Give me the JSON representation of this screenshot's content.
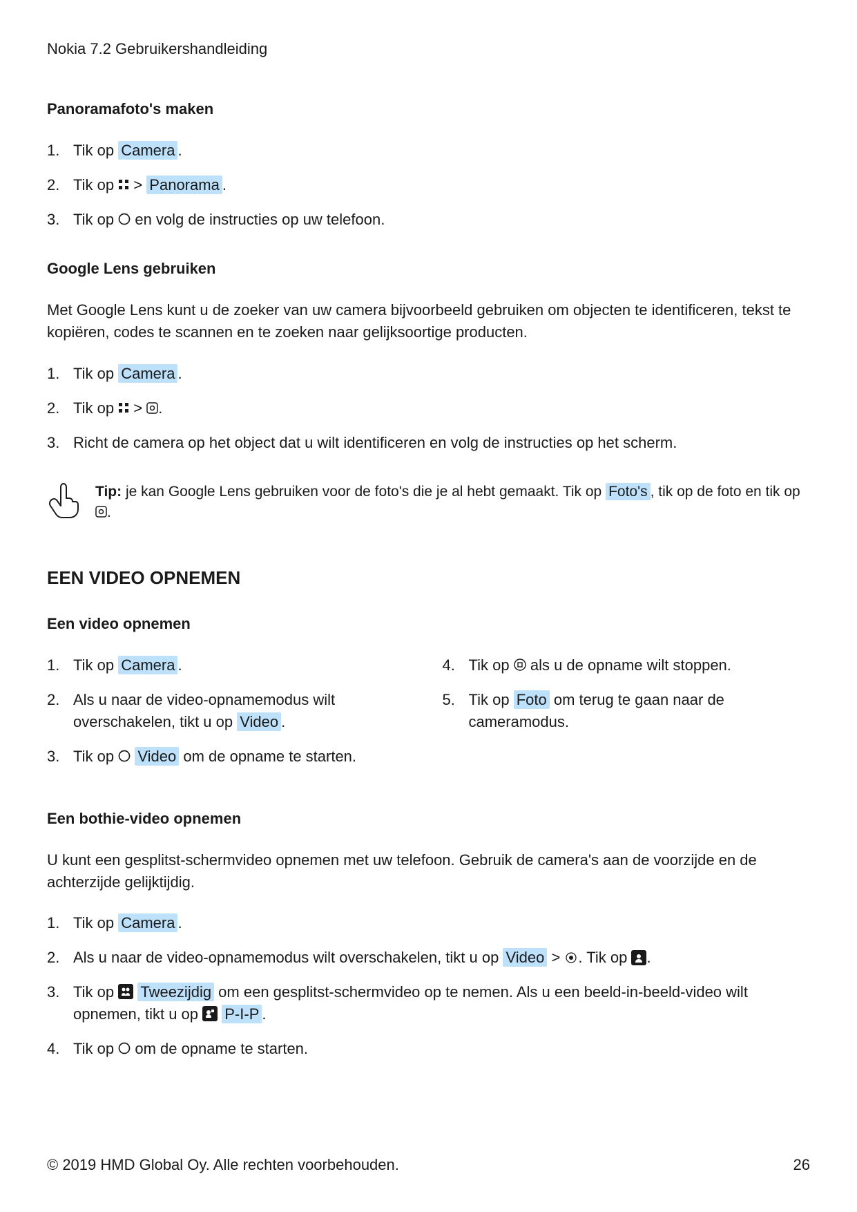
{
  "header": {
    "title": "Nokia 7.2 Gebruikershandleiding"
  },
  "s1": {
    "heading": "Panoramafoto's maken",
    "li1_a": "Tik op ",
    "li1_hl": "Camera",
    "li1_b": ".",
    "li2_a": "Tik op ",
    "li2_b": " > ",
    "li2_hl": "Panorama",
    "li2_c": ".",
    "li3_a": "Tik op ",
    "li3_b": " en volg de instructies op uw telefoon."
  },
  "s2": {
    "heading": "Google Lens gebruiken",
    "para": "Met Google Lens kunt u de zoeker van uw camera bijvoorbeeld gebruiken om objecten te identificeren, tekst te kopiëren, codes te scannen en te zoeken naar gelijksoortige producten.",
    "li1_a": "Tik op ",
    "li1_hl": "Camera",
    "li1_b": ".",
    "li2_a": "Tik op ",
    "li2_b": " > ",
    "li2_c": ".",
    "li3": "Richt de camera op het object dat u wilt identificeren en volg de instructies op het scherm.",
    "tip_label": "Tip:",
    "tip_a": " je kan Google Lens gebruiken voor de foto's die je al hebt gemaakt. Tik op ",
    "tip_hl": "Foto's",
    "tip_b": ", tik op de foto en tik op ",
    "tip_c": "."
  },
  "s3": {
    "heading": "EEN VIDEO OPNEMEN",
    "sub1": "Een video opnemen",
    "li1_a": "Tik op ",
    "li1_hl": "Camera",
    "li1_b": ".",
    "li2_a": "Als u naar de video-opnamemodus wilt overschakelen, tikt u op ",
    "li2_hl": "Video",
    "li2_b": ".",
    "li3_a": "Tik op ",
    "li3_hl": "Video",
    "li3_b": " om de opname te starten.",
    "li4_a": "Tik op ",
    "li4_b": " als u de opname wilt stoppen.",
    "li5_a": "Tik op ",
    "li5_hl": "Foto",
    "li5_b": " om terug te gaan naar de cameramodus."
  },
  "s4": {
    "heading": "Een bothie-video opnemen",
    "para": "U kunt een gesplitst-schermvideo opnemen met uw telefoon. Gebruik de camera's aan de voorzijde en de achterzijde gelijktijdig.",
    "li1_a": "Tik op ",
    "li1_hl": "Camera",
    "li1_b": ".",
    "li2_a": "Als u naar de video-opnamemodus wilt overschakelen, tikt u op ",
    "li2_hl": "Video",
    "li2_b": " > ",
    "li2_c": ". Tik op ",
    "li2_d": ".",
    "li3_a": "Tik op ",
    "li3_hl1": "Tweezijdig",
    "li3_b": " om een gesplitst-schermvideo op te nemen. Als u een beeld-in-beeld-video wilt opnemen, tikt u op ",
    "li3_hl2": "P-I-P",
    "li3_c": ".",
    "li4_a": "Tik op ",
    "li4_b": " om de opname te starten."
  },
  "footer": {
    "copyright": "© 2019 HMD Global Oy. Alle rechten voorbehouden.",
    "page": "26"
  }
}
